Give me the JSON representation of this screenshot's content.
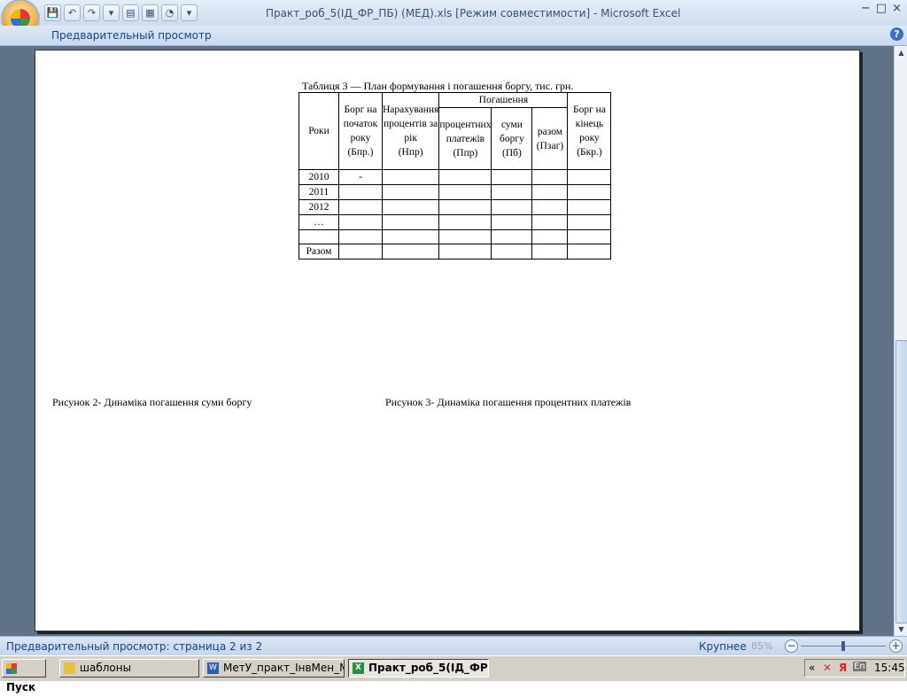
{
  "window": {
    "title": "Практ_роб_5(ІД_ФР_ПБ) (МЕД).xls  [Режим совместимости]  -  Microsoft Excel",
    "controls": [
      "−",
      "□",
      "×"
    ]
  },
  "qat": [
    "💾",
    "↶",
    "↷",
    "▾",
    "▤",
    "▦",
    "◔",
    "▾"
  ],
  "ribbon": {
    "active_tab": "Предварительный просмотр",
    "help": "?"
  },
  "page": {
    "table_caption": "Таблиця 3 — План формування і погашення боргу, тис. грн.",
    "headers": {
      "years": "Роки",
      "debt_start": "Борг на початок року",
      "debt_start_sym": "(Бпр.)",
      "accrued": "Нарахування процентів за рік",
      "accrued_sym": "(Нпр)",
      "repayment": "Погашення",
      "interest": "процентних платежів",
      "interest_sym": "(Ппр)",
      "principal": "суми боргу",
      "principal_sym": "(Пб)",
      "total": "разом",
      "total_sym": "(Пзаг)",
      "debt_end": "Борг на кінець року",
      "debt_end_sym": "(Бкр.)"
    },
    "rows": [
      "2010",
      "2011",
      "2012",
      "…",
      "",
      "Разом"
    ],
    "first_row_value": "-",
    "figure2": "Рисунок 2- Динаміка погашення суми боргу",
    "figure3": "Рисунок 3- Динаміка погашення процентних платежів"
  },
  "status": {
    "text": "Предварительный просмотр: страница 2 из 2",
    "zoom_button": "Крупнее",
    "zoom_level": "85%"
  },
  "taskbar": {
    "start": "Пуск",
    "tasks": [
      "шаблоны",
      "МетУ_практ_ІнвМен_М...",
      "Практ_роб_5(ІД_ФР..."
    ],
    "tray": {
      "arrows": "«",
      "lang": "En",
      "time": "15:45"
    }
  }
}
